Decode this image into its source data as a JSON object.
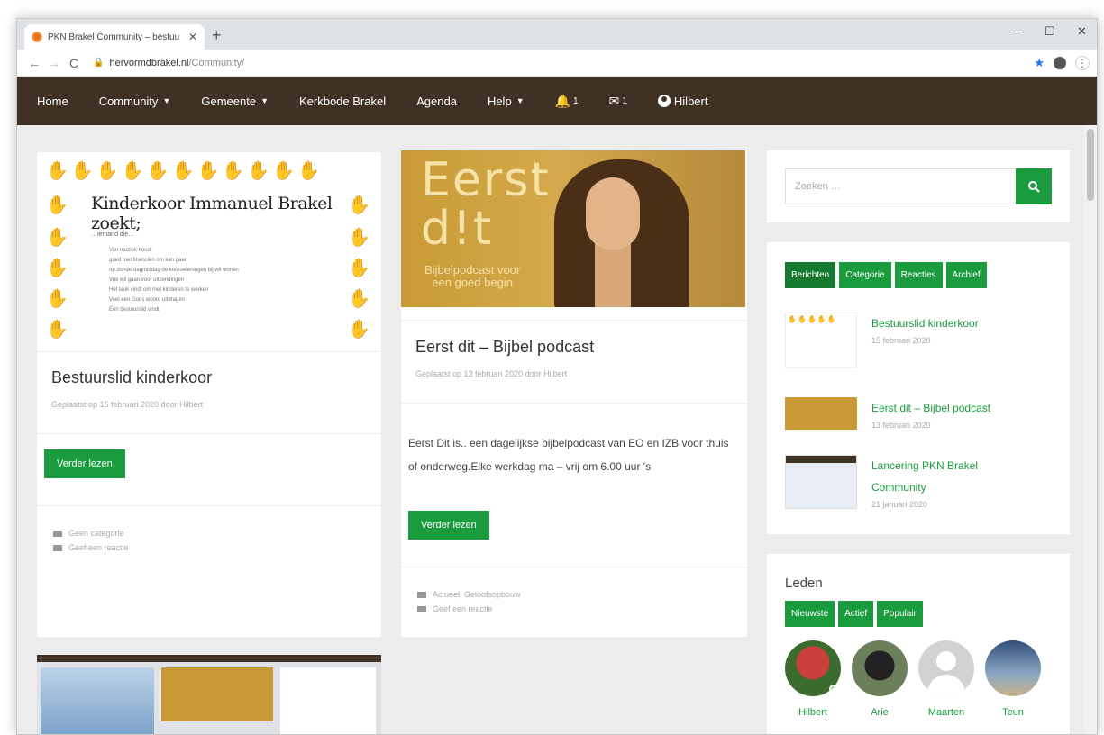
{
  "browser": {
    "tab_title": "PKN Brakel Community – bestuu",
    "tab_close": "✕",
    "new_tab": "+",
    "url_host": "hervormdbrakel.nl",
    "url_path": "/Community/",
    "min": "–",
    "max": "☐",
    "close": "✕"
  },
  "nav": {
    "home": "Home",
    "community": "Community",
    "gemeente": "Gemeente",
    "kerkbode": "Kerkbode Brakel",
    "agenda": "Agenda",
    "help": "Help",
    "notifications_count": "1",
    "messages_count": "1",
    "user": "Hilbert"
  },
  "posts": [
    {
      "title": "Bestuurslid kinderkoor",
      "meta": "Geplaatst op 15 februari 2020 door Hilbert",
      "read_more": "Verder lezen",
      "category": "Geen categorie",
      "comment": "Geef een reactie",
      "image": {
        "heading": "Kinderkoor Immanuel Brakel zoekt;",
        "sub": "…iemand die…",
        "list": [
          "Van muziek houdt",
          "goed met financiën om kan gaan",
          "op donderdagmiddag de kooroefeningen bij wil wonen",
          "Vrei wil gaan voor uitzendingen",
          "Het leuk vindt om met kinderen te werken",
          "Veel een Gods woord uitdragen",
          "Een bestuurslid vindt"
        ]
      }
    },
    {
      "title": "Eerst dit – Bijbel podcast",
      "meta": "Geplaatst op 13 februari 2020 door Hilbert",
      "excerpt": "Eerst Dit is.. een dagelijkse bijbelpodcast van EO en IZB voor thuis of onderweg.Elke werkdag ma – vrij om 6.00 uur 's",
      "read_more": "Verder lezen",
      "category": "Actueel, Geloofsopbouw",
      "comment": "Geef een reactie",
      "image": {
        "line1": "Eerst",
        "line2": "d!t",
        "small1": "Bijbelpodcast voor",
        "small2": "een goed begin"
      }
    }
  ],
  "sidebar": {
    "search_placeholder": "Zoeken …",
    "tabs": [
      "Berichten",
      "Categorie",
      "Reacties",
      "Archief"
    ],
    "recent": [
      {
        "title": "Bestuurslid kinderkoor",
        "date": "15 februari 2020"
      },
      {
        "title": "Eerst dit – Bijbel podcast",
        "date": "13 februari 2020"
      },
      {
        "title": "Lancering PKN Brakel Community",
        "date": "21 januari 2020"
      }
    ],
    "members_title": "Leden",
    "member_tabs": [
      "Nieuwste",
      "Actief",
      "Populair"
    ],
    "members": [
      "Hilbert",
      "Arie",
      "Maarten",
      "Teun"
    ]
  },
  "colors": {
    "nav_bg": "#3f3224",
    "accent": "#1a9c3e"
  }
}
